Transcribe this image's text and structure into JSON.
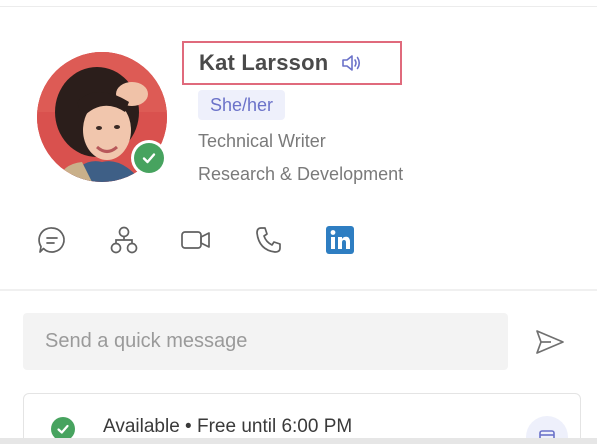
{
  "profile": {
    "name": "Kat Larsson",
    "pronouns": "She/her",
    "job_title": "Technical Writer",
    "department": "Research & Development",
    "presence": "available"
  },
  "icons": {
    "name_audio": "speaker-icon",
    "presence": "checkmark-icon",
    "actions": [
      "chat-icon",
      "org-chart-icon",
      "video-call-icon",
      "phone-icon",
      "linkedin-icon"
    ],
    "send": "send-icon",
    "status": "checkmark-icon",
    "status_action": "calendar-icon"
  },
  "quick_message": {
    "placeholder": "Send a quick message"
  },
  "status": {
    "text": "Available • Free until 6:00 PM"
  },
  "colors": {
    "highlight_border": "#e06a7c",
    "presence_green": "#47a35f",
    "accent": "#6b72c9",
    "linkedin": "#2e7ec2"
  }
}
